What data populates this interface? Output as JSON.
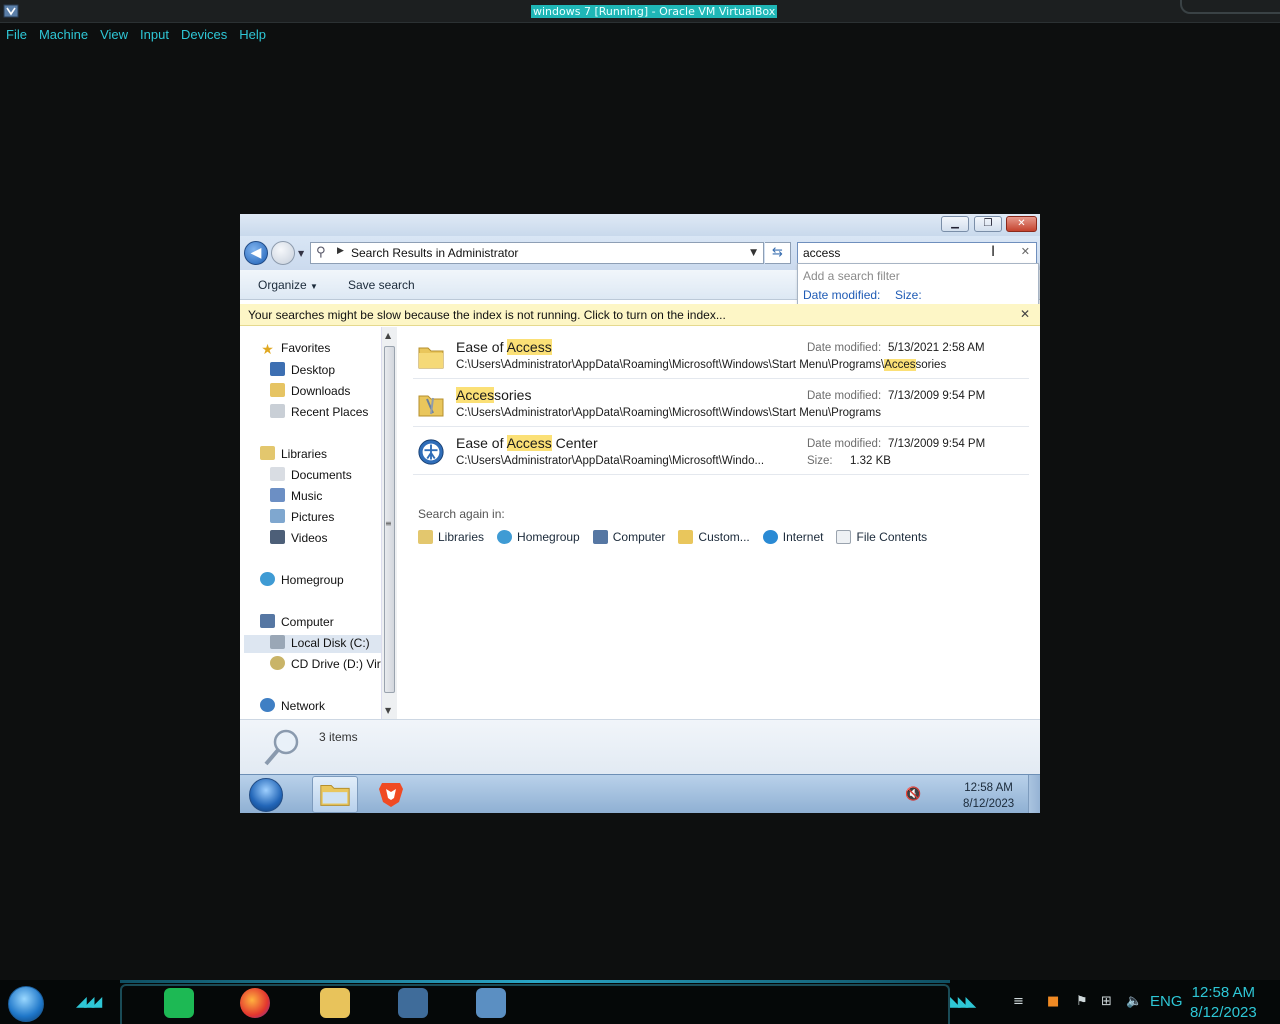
{
  "host": {
    "window_title": "windows 7 [Running] - Oracle VM VirtualBox",
    "menu": [
      "File",
      "Machine",
      "View",
      "Input",
      "Devices",
      "Help"
    ],
    "clock_time": "12:58 AM",
    "clock_date": "8/12/2023",
    "lang": "ENG",
    "accent_color": "#2ec7d6"
  },
  "explorer": {
    "address": "Search Results in Administrator",
    "search_value": "access",
    "search_popup": {
      "hint": "Add a search filter",
      "filter_date": "Date modified:",
      "filter_size": "Size:"
    },
    "commands": {
      "organize": "Organize",
      "save_search": "Save search"
    },
    "infobar": "Your searches might be slow because the index is not running.  Click to turn on the index...",
    "nav": {
      "favorites": "Favorites",
      "desktop": "Desktop",
      "downloads": "Downloads",
      "recent": "Recent Places",
      "libraries": "Libraries",
      "documents": "Documents",
      "music": "Music",
      "pictures": "Pictures",
      "videos": "Videos",
      "homegroup": "Homegroup",
      "computer": "Computer",
      "local_disk": "Local Disk (C:)",
      "cd_drive": "CD Drive (D:) Virt",
      "network": "Network"
    },
    "results": [
      {
        "name_pre": "Ease of ",
        "name_hl": "Access",
        "name_post": "",
        "path_pre": "C:\\Users\\Administrator\\AppData\\Roaming\\Microsoft\\Windows\\Start Menu\\Programs\\",
        "path_hl": "Acces",
        "path_post": "sories",
        "date_label": "Date modified:",
        "date_value": "5/13/2021 2:58 AM",
        "icon": "folder-icon"
      },
      {
        "name_pre": "",
        "name_hl": "Acces",
        "name_post": "sories",
        "path_pre": "C:\\Users\\Administrator\\AppData\\Roaming\\Microsoft\\Windows\\Start Menu\\Programs",
        "path_hl": "",
        "path_post": "",
        "date_label": "Date modified:",
        "date_value": "7/13/2009 9:54 PM",
        "icon": "accessories-folder-icon"
      },
      {
        "name_pre": "Ease of ",
        "name_hl": "Access",
        "name_post": " Center",
        "path_pre": "C:\\Users\\Administrator\\AppData\\Roaming\\Microsoft\\Windo...",
        "path_hl": "",
        "path_post": "",
        "date_label": "Date modified:",
        "date_value": "7/13/2009 9:54 PM",
        "size_label": "Size:",
        "size_value": "1.32 KB",
        "icon": "ease-of-access-icon"
      }
    ],
    "search_again": {
      "title": "Search again in:",
      "options": [
        "Libraries",
        "Homegroup",
        "Computer",
        "Custom...",
        "Internet",
        "File Contents"
      ]
    },
    "item_count": "3 items"
  },
  "vm_taskbar": {
    "time": "12:58 AM",
    "date": "8/12/2023"
  },
  "highlight_color": "#fbe076"
}
